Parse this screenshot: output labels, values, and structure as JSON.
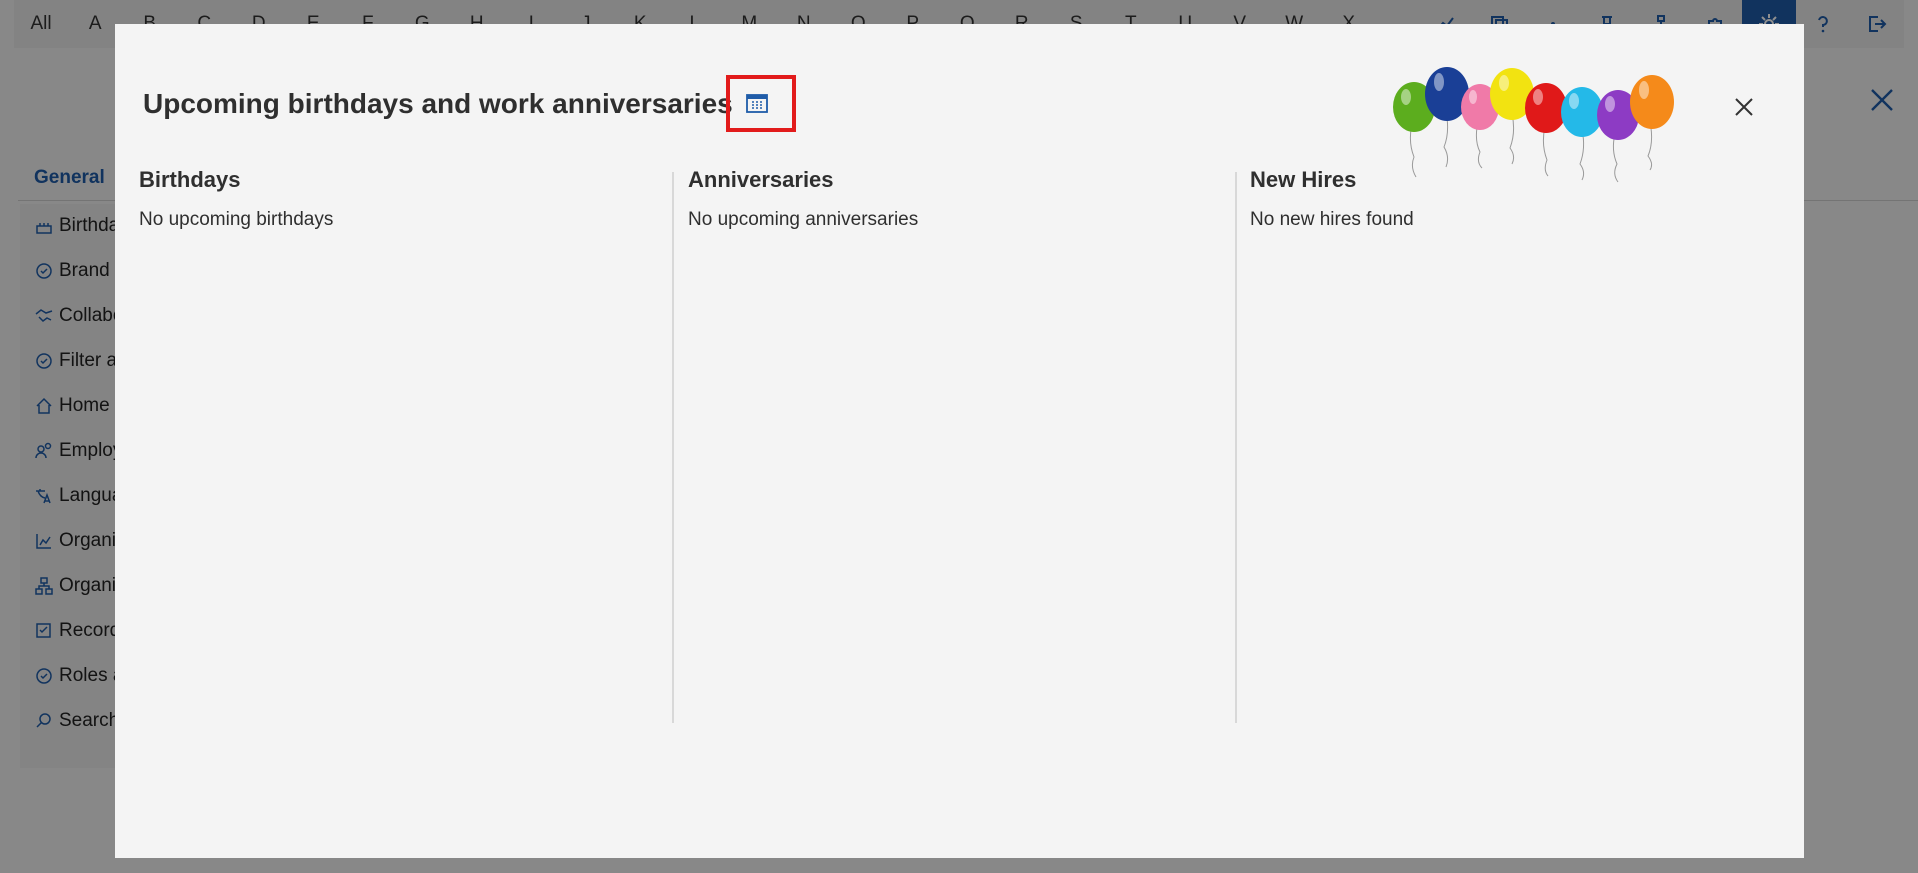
{
  "topbar": {
    "letters": [
      "All",
      "A",
      "B",
      "C",
      "D",
      "E",
      "F",
      "G",
      "H",
      "I",
      "J",
      "K",
      "L",
      "M",
      "N",
      "O",
      "P",
      "Q",
      "R",
      "S",
      "T",
      "U",
      "V",
      "W",
      "X"
    ]
  },
  "background": {
    "tab_label": "General",
    "sidebar_items": [
      {
        "label": "Birthdays",
        "icon": "cake-icon"
      },
      {
        "label": "Brand k",
        "icon": "badge-check-icon"
      },
      {
        "label": "Collabo",
        "icon": "handshake-icon"
      },
      {
        "label": "Filter a",
        "icon": "badge-check-icon"
      },
      {
        "label": "Home",
        "icon": "home-icon"
      },
      {
        "label": "Employ",
        "icon": "people-icon"
      },
      {
        "label": "Langua",
        "icon": "translate-icon"
      },
      {
        "label": "Organi",
        "icon": "chart-icon"
      },
      {
        "label": "Organi",
        "icon": "org-chart-icon"
      },
      {
        "label": "Record",
        "icon": "checklist-icon"
      },
      {
        "label": "Roles a",
        "icon": "badge-check-icon"
      },
      {
        "label": "Search",
        "icon": "search-icon"
      }
    ]
  },
  "modal": {
    "title": "Upcoming birthdays and work anniversaries",
    "columns": [
      {
        "heading": "Birthdays",
        "empty": "No upcoming birthdays"
      },
      {
        "heading": "Anniversaries",
        "empty": "No upcoming anniversaries"
      },
      {
        "heading": "New Hires",
        "empty": "No new hires found"
      }
    ]
  },
  "colors": {
    "accent": "#1f5ca8",
    "highlight_box": "#e21b1b",
    "balloons": [
      "#5cad1e",
      "#1a3f96",
      "#f07aa8",
      "#f2e311",
      "#e01919",
      "#24b9e8",
      "#8d3bc4",
      "#f58a1a"
    ]
  }
}
